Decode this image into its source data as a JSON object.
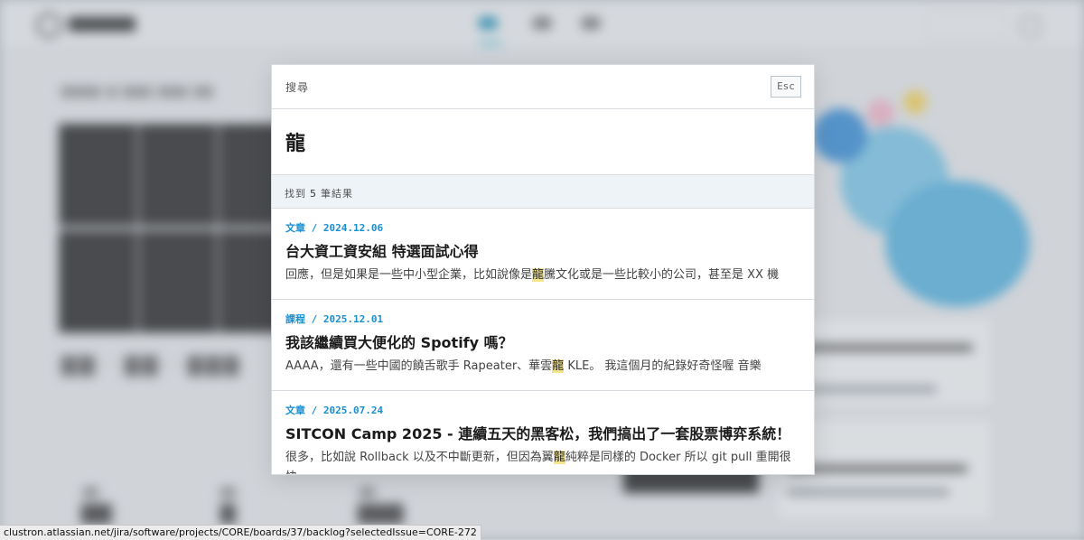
{
  "search_modal": {
    "title": "搜尋",
    "esc_label": "Esc",
    "query": "龍",
    "result_prefix": "找到",
    "result_count": "5",
    "result_suffix": "筆結果",
    "results": [
      {
        "meta": "文章 / 2024.12.06",
        "title": "台大資工資安組 特選面試心得",
        "snippet_before": "回應，但是如果是一些中小型企業，比如說像是",
        "highlight": "龍",
        "snippet_after": "騰文化或是一些比較小的公司，甚至是 XX 機"
      },
      {
        "meta": "課程 / 2025.12.01",
        "title": "我該繼續買大便化的 Spotify 嗎？",
        "snippet_before": "AAAA，還有一些中國的饒舌歌手 Rapeater、華雲",
        "highlight": "龍",
        "snippet_after": " KLE。 我這個月的紀錄好奇怪喔 音樂"
      },
      {
        "meta": "文章 / 2025.07.24",
        "title": "SITCON Camp 2025 - 連續五天的黑客松，我們搞出了一套股票博弈系統！",
        "snippet_before": "很多，比如說 Rollback 以及不中斷更新，但因為翼",
        "highlight": "龍",
        "snippet_after": "純粹是同樣的 Docker 所以 git pull 重開很快。"
      }
    ]
  },
  "status_bar": {
    "url": "clustron.atlassian.net/jira/software/projects/CORE/boards/37/backlog?selectedIssue=CORE-272"
  },
  "colors": {
    "accent_blue": "#1a8fd0",
    "highlight": "#f7e58a",
    "count_bar_bg": "#eef3f8"
  },
  "icons": {
    "logo": "logo-icon"
  }
}
